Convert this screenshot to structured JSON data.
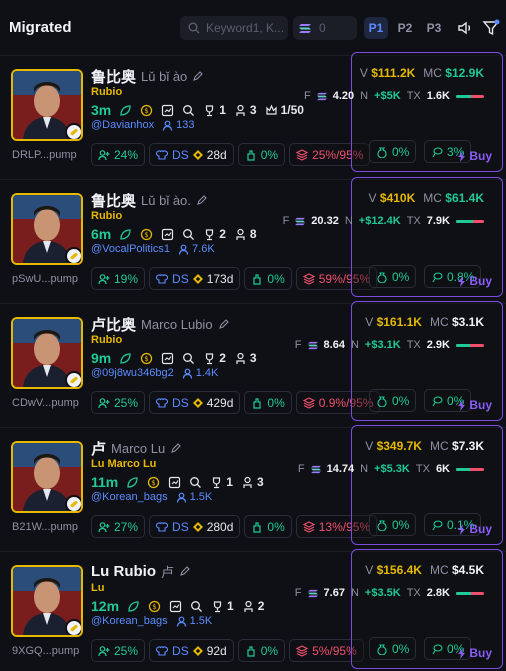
{
  "header": {
    "title": "Migrated",
    "search_placeholder": "Keyword1, K...",
    "sol_filter_value": "0",
    "tabs": [
      "P1",
      "P2",
      "P3"
    ],
    "active_tab": "P1"
  },
  "rows": [
    {
      "name": "鲁比奥",
      "subname": "Lǔ bǐ ào",
      "ticker": "Rubio",
      "age": "3m",
      "trophies": "1",
      "devs": "3",
      "crown": "1/50",
      "handle": "@Davianhox",
      "followers": "133",
      "address": "DRLP...pump",
      "chips": {
        "holders": "24%",
        "ds": "28d",
        "top10": "0%",
        "snipers": "25%/95%",
        "dev": "0%",
        "bundle": "3%"
      },
      "volume": "$111.2K",
      "mc": "$12.9K",
      "f": "4.20",
      "n": "+$5K",
      "tx": "1.6K",
      "bar_ratio": 0.55,
      "mc_color": "#20c997"
    },
    {
      "name": "鲁比奥",
      "subname": "Lǔ bǐ ào.",
      "ticker": "Rubio",
      "age": "6m",
      "trophies": "2",
      "devs": "8",
      "crown": "",
      "handle": "@VocalPolitics1",
      "followers": "7.6K",
      "address": "pSwU...pump",
      "chips": {
        "holders": "19%",
        "ds": "173d",
        "top10": "0%",
        "snipers": "59%/95%",
        "dev": "0%",
        "bundle": "0.8%"
      },
      "volume": "$410K",
      "mc": "$61.4K",
      "f": "20.32",
      "n": "+$12.4K",
      "tx": "7.9K",
      "bar_ratio": 0.6,
      "mc_color": "#20c997"
    },
    {
      "name": "卢比奥",
      "subname": "Marco Lubio",
      "ticker": "Rubio",
      "age": "9m",
      "trophies": "2",
      "devs": "3",
      "crown": "",
      "handle": "@09j8wu346bg2",
      "followers": "1.4K",
      "address": "CDwV...pump",
      "chips": {
        "holders": "25%",
        "ds": "429d",
        "top10": "0%",
        "snipers": "0.9%/95%",
        "dev": "0%",
        "bundle": "0%"
      },
      "volume": "$161.1K",
      "mc": "$3.1K",
      "f": "8.64",
      "n": "+$3.1K",
      "tx": "2.9K",
      "bar_ratio": 0.5,
      "mc_color": "#f2f3f8"
    },
    {
      "name": "卢",
      "subname": "Marco Lu",
      "ticker": "Lu Marco Lu",
      "age": "11m",
      "trophies": "1",
      "devs": "3",
      "crown": "",
      "handle": "@Korean_bags",
      "followers": "1.5K",
      "address": "B21W...pump",
      "chips": {
        "holders": "27%",
        "ds": "280d",
        "top10": "0%",
        "snipers": "13%/95%",
        "dev": "0%",
        "bundle": "0.1%"
      },
      "volume": "$349.7K",
      "mc": "$7.3K",
      "f": "14.74",
      "n": "+$5.3K",
      "tx": "6K",
      "bar_ratio": 0.5,
      "mc_color": "#f2f3f8"
    },
    {
      "name": "Lu Rubio",
      "subname": "卢",
      "ticker": "Lu",
      "age": "12m",
      "trophies": "1",
      "devs": "2",
      "crown": "",
      "handle": "@Korean_bags",
      "followers": "1.5K",
      "address": "9XGQ...pump",
      "chips": {
        "holders": "25%",
        "ds": "92d",
        "top10": "0%",
        "snipers": "5%/95%",
        "dev": "0%",
        "bundle": "0%"
      },
      "volume": "$156.4K",
      "mc": "$4.5K",
      "f": "7.67",
      "n": "+$3.5K",
      "tx": "2.8K",
      "bar_ratio": 0.55,
      "mc_color": "#f2f3f8"
    }
  ],
  "labels": {
    "v": "V",
    "mc": "MC",
    "f": "F",
    "n": "N",
    "tx": "TX",
    "ds": "DS",
    "buy": "Buy"
  },
  "colors": {
    "accent": "#7d4ce0",
    "green": "#20c997",
    "red": "#f0506e",
    "gold": "#e6b800",
    "blue": "#5b8cff"
  }
}
